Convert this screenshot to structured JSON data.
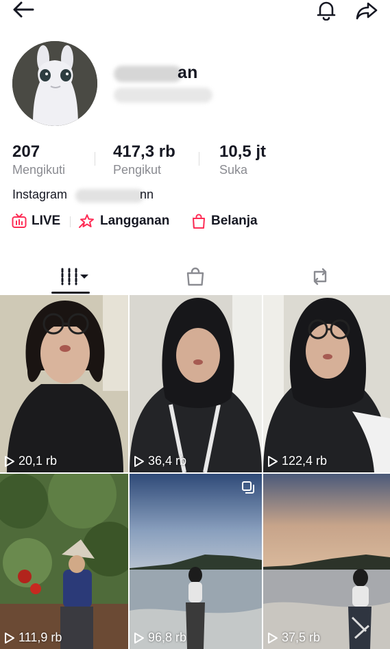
{
  "profile": {
    "name_visible": "an",
    "avatar_icon": "avatar-image"
  },
  "stats": [
    {
      "value": "207",
      "label": "Mengikuti"
    },
    {
      "value": "417,3 rb",
      "label": "Pengikut"
    },
    {
      "value": "10,5 jt",
      "label": "Suka"
    }
  ],
  "bio": {
    "prefix": "Instagram",
    "suffix": "nn"
  },
  "links": [
    {
      "label": "LIVE",
      "icon": "live-tv-icon"
    },
    {
      "label": "Langganan",
      "icon": "subscription-icon"
    },
    {
      "label": "Belanja",
      "icon": "shopping-bag-icon"
    }
  ],
  "tabs": [
    {
      "icon": "grid-videos-icon"
    },
    {
      "icon": "shop-bag-icon"
    },
    {
      "icon": "repost-icon"
    }
  ],
  "videos": [
    {
      "views": "20,1 rb"
    },
    {
      "views": "36,4 rb"
    },
    {
      "views": "122,4 rb"
    },
    {
      "views": "111,9 rb"
    },
    {
      "views": "96,8 rb"
    },
    {
      "views": "37,5 rb"
    }
  ],
  "colors": {
    "accent": "#fe2c55",
    "text": "#161823",
    "muted": "#8a8b91"
  }
}
